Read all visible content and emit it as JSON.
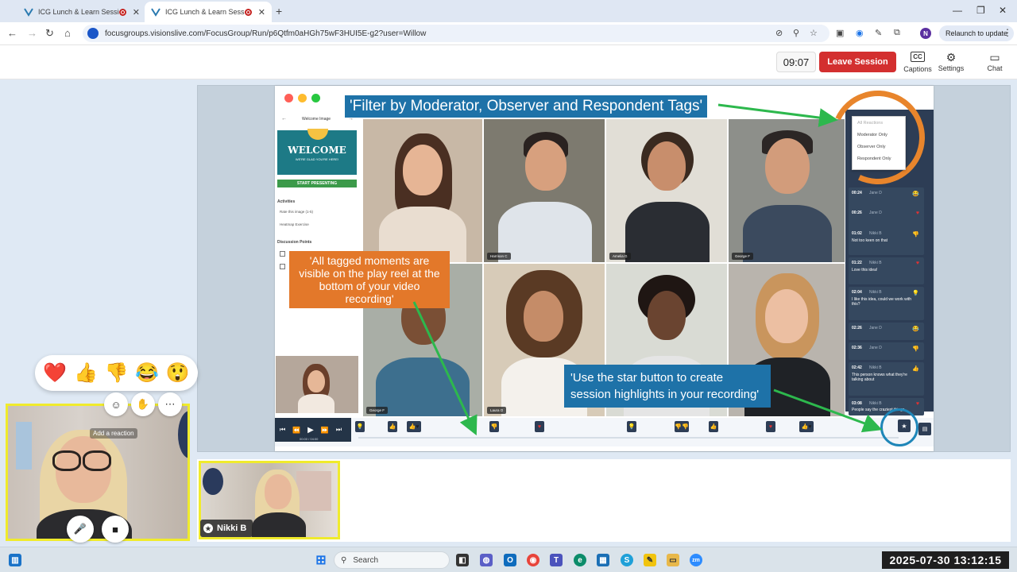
{
  "browser": {
    "tabs": [
      {
        "label": "ICG Lunch & Learn Session",
        "active": false
      },
      {
        "label": "ICG Lunch & Learn Session",
        "active": true
      }
    ],
    "url": "focusgroups.visionslive.com/FocusGroup/Run/p6Qtfm0aHGh75wF3HUI5E-g2?user=Willow",
    "profile_initial": "N",
    "relaunch_label": "Relaunch to update"
  },
  "header": {
    "timer": "09:07",
    "leave_label": "Leave Session",
    "captions_label": "Captions",
    "captions_icon_text": "CC",
    "settings_label": "Settings",
    "chat_label": "Chat"
  },
  "slide": {
    "callout_filter": "'Filter by Moderator, Observer and Respondent Tags'",
    "callout_tagged": "'All tagged moments are visible on the play reel at the bottom of your video recording'",
    "callout_star": "'Use the star button to create session highlights in your recording'",
    "mini_panel": {
      "title": "Welcome Image",
      "welcome_text": "WELCOME",
      "welcome_sub": "WE'RE GLAD YOU'RE HERE!",
      "start_label": "START PRESENTING",
      "activities_label": "Activities",
      "activity_items": [
        "Rate this image (1-5)",
        "Heatmap Exercise"
      ],
      "discussion_label": "Discussion Points"
    },
    "filter_options": [
      "All Reactions",
      "Moderator Only",
      "Observer Only",
      "Respondent Only"
    ],
    "tiles": [
      {
        "name": ""
      },
      {
        "name": "Harrison C"
      },
      {
        "name": "Amelia G"
      },
      {
        "name": "George F"
      },
      {
        "name": "George F"
      },
      {
        "name": "Laura O"
      },
      {
        "name": ""
      },
      {
        "name": ""
      }
    ],
    "reactions": [
      {
        "time": "00:24",
        "name": "Jane D",
        "text": "",
        "icon": "laugh-icon"
      },
      {
        "time": "00:26",
        "name": "Jane D",
        "text": "",
        "icon": "heart-icon"
      },
      {
        "time": "01:02",
        "name": "Nikki B",
        "text": "Not too keen on that",
        "icon": "thumbs-down-icon"
      },
      {
        "time": "01:22",
        "name": "Nikki B",
        "text": "Love this idea!",
        "icon": "heart-icon"
      },
      {
        "time": "02:04",
        "name": "Nikki B",
        "text": "I like this idea, could we work with this?",
        "icon": "bulb-icon"
      },
      {
        "time": "02:26",
        "name": "Jane D",
        "text": "",
        "icon": "laugh-icon"
      },
      {
        "time": "02:36",
        "name": "Jane D",
        "text": "",
        "icon": "thumbs-down-icon"
      },
      {
        "time": "02:42",
        "name": "Nikki B",
        "text": "This person knows what they're talking about",
        "icon": "thumbs-up-icon"
      },
      {
        "time": "03:08",
        "name": "Nikki B",
        "text": "People say the craziest things",
        "icon": "heart-icon"
      }
    ],
    "player_time": "00:00 / 04:00"
  },
  "reactions_bar": {
    "items": [
      "❤️",
      "👍",
      "👎",
      "😂",
      "😲"
    ],
    "add_reaction_tip": "Add a reaction"
  },
  "participant": {
    "name": "Nikki B"
  },
  "taskbar": {
    "search_label": "Search",
    "clock": "2025-07-30  13:12:15"
  },
  "colors": {
    "leave": "#d32f2f",
    "callout_blue": "#1e72a8",
    "callout_orange": "#e3782a",
    "highlight_border": "#f0eb2c"
  }
}
